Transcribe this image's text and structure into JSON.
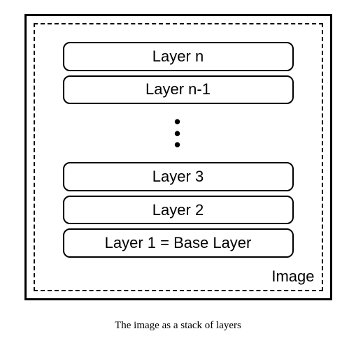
{
  "layers": {
    "top1": "Layer n",
    "top2": "Layer n-1",
    "mid3": "Layer 3",
    "mid2": "Layer 2",
    "base": "Layer 1 = Base Layer"
  },
  "image_label": "Image",
  "caption": "The image as a stack of layers"
}
